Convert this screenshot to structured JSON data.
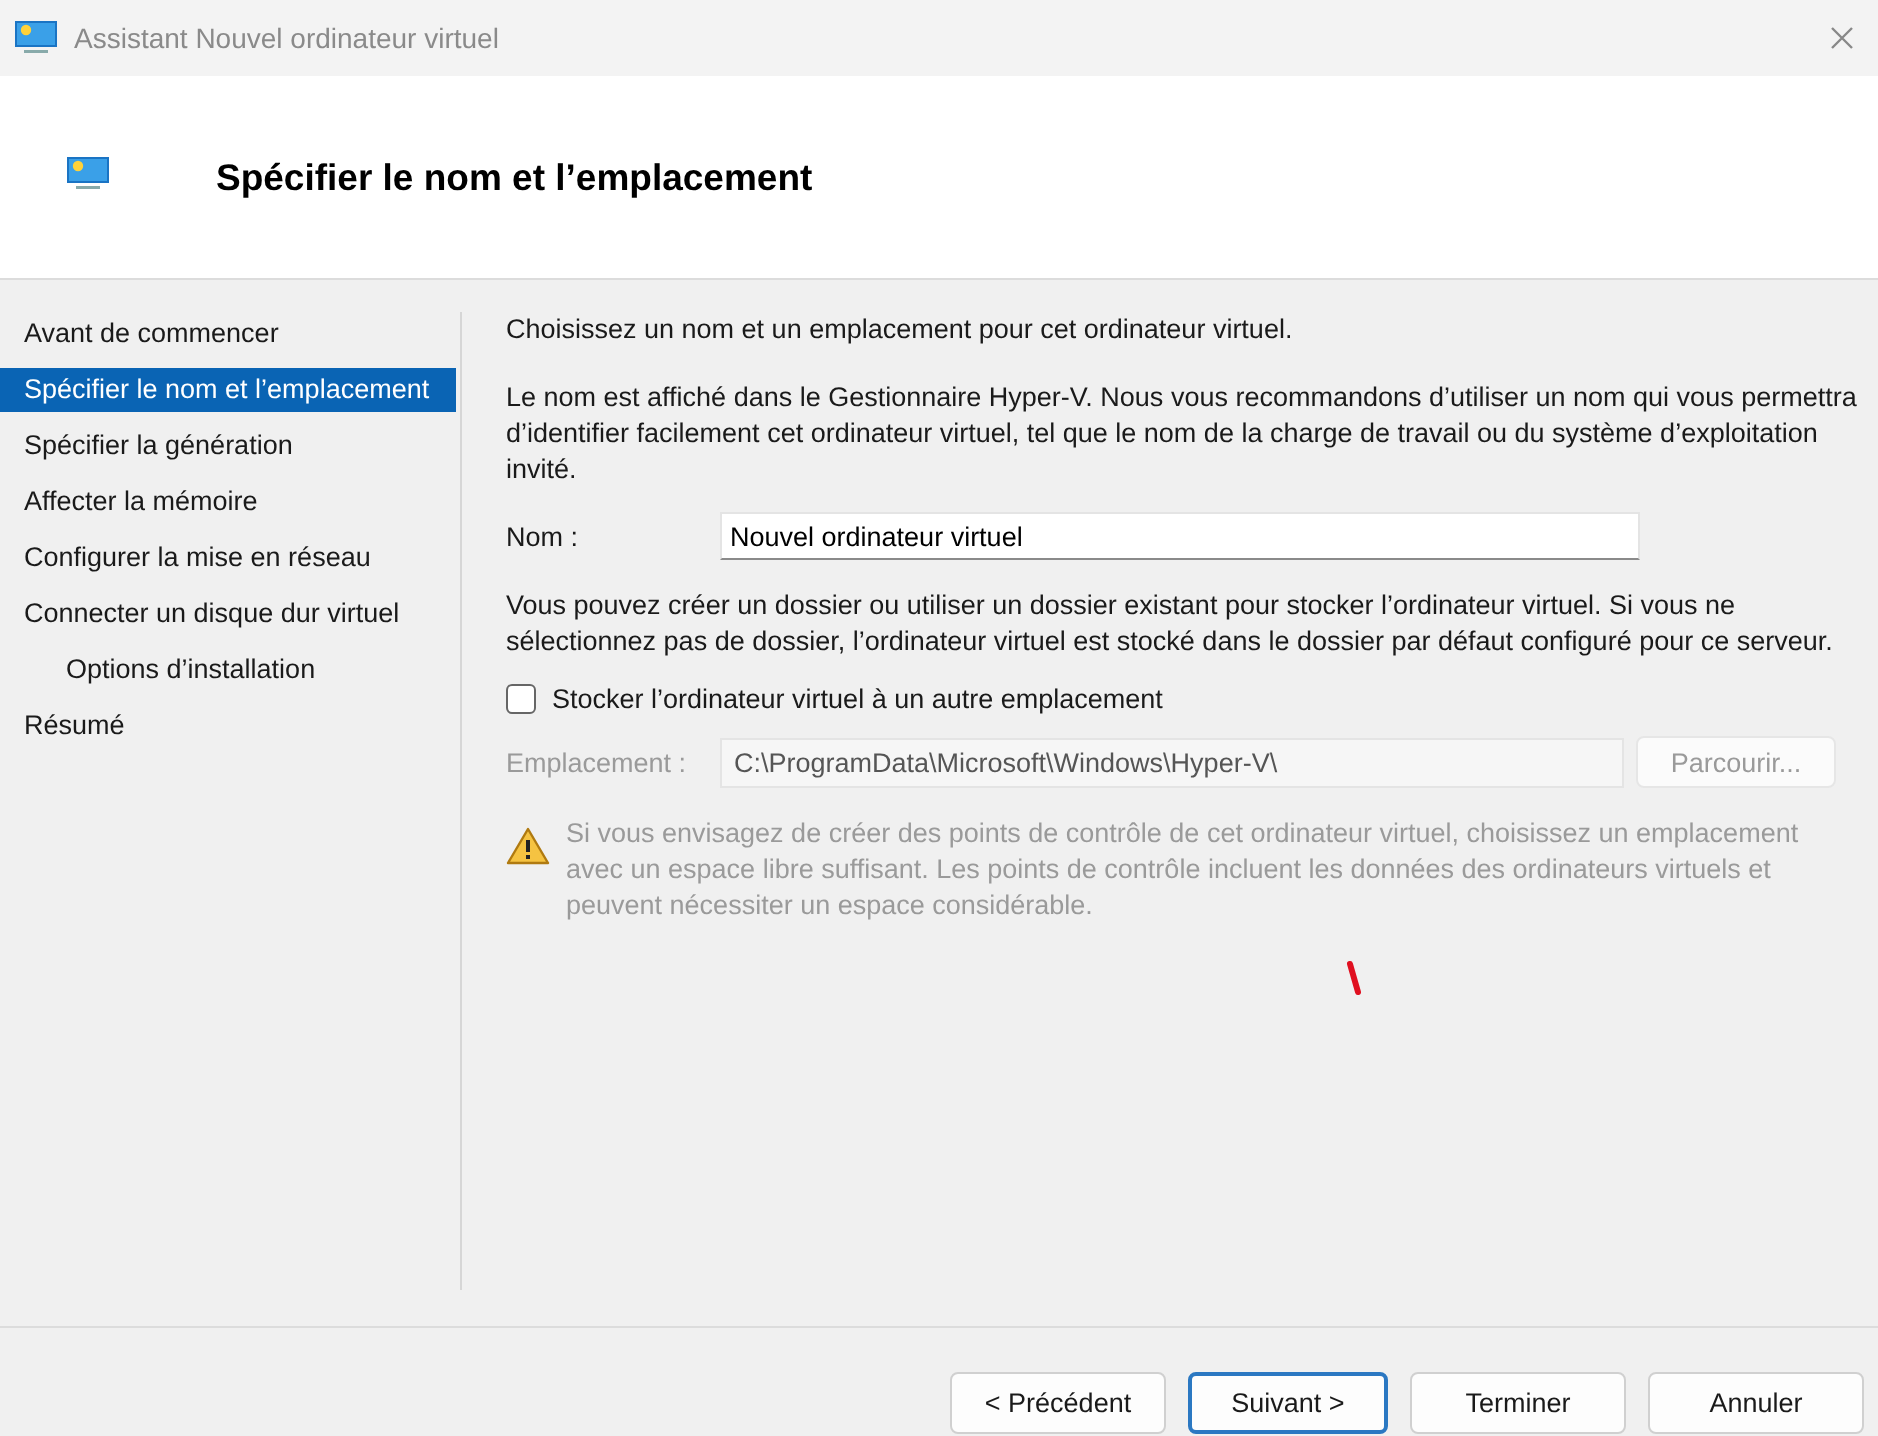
{
  "window": {
    "title": "Assistant Nouvel ordinateur virtuel"
  },
  "header": {
    "title": "Spécifier le nom et l’emplacement"
  },
  "sidebar": {
    "items": [
      {
        "label": "Avant de commencer",
        "selected": false
      },
      {
        "label": "Spécifier le nom et l’emplacement",
        "selected": true
      },
      {
        "label": "Spécifier la génération",
        "selected": false
      },
      {
        "label": "Affecter la mémoire",
        "selected": false
      },
      {
        "label": "Configurer la mise en réseau",
        "selected": false
      },
      {
        "label": "Connecter un disque dur virtuel",
        "selected": false,
        "children": [
          {
            "label": "Options d’installation",
            "selected": false
          }
        ]
      },
      {
        "label": "Résumé",
        "selected": false
      }
    ]
  },
  "content": {
    "intro": "Choisissez un nom et un emplacement pour cet ordinateur virtuel.",
    "description": "Le nom est affiché dans le Gestionnaire Hyper-V. Nous vous recommandons d’utiliser un nom qui vous permettra d’identifier facilement cet ordinateur virtuel, tel que le nom de la charge de travail ou du système d’exploitation invité.",
    "name_field": {
      "label": "Nom :",
      "value": "Nouvel ordinateur virtuel"
    },
    "folder_note": "Vous pouvez créer un dossier ou utiliser un dossier existant pour stocker l’ordinateur virtuel. Si vous ne sélectionnez pas de dossier, l’ordinateur virtuel est stocké dans le dossier par défaut configuré pour ce serveur.",
    "store_checkbox": {
      "label": "Stocker l’ordinateur virtuel à un autre emplacement",
      "checked": false
    },
    "location_field": {
      "label": "Emplacement :",
      "value": "C:\\ProgramData\\Microsoft\\Windows\\Hyper-V\\",
      "disabled": true
    },
    "browse_button": {
      "label": "Parcourir...",
      "disabled": true
    },
    "warning": {
      "text": "Si vous envisagez de créer des points de contrôle de cet ordinateur virtuel, choisissez un emplacement avec un espace libre suffisant. Les points de contrôle incluent les données des ordinateurs virtuels et peuvent nécessiter un espace considérable.",
      "disabled": true
    }
  },
  "buttons": [
    {
      "label": "< Précédent",
      "default": false
    },
    {
      "label": "Suivant >",
      "default": true
    },
    {
      "label": "Terminer",
      "default": false
    },
    {
      "label": "Annuler",
      "default": false
    }
  ]
}
